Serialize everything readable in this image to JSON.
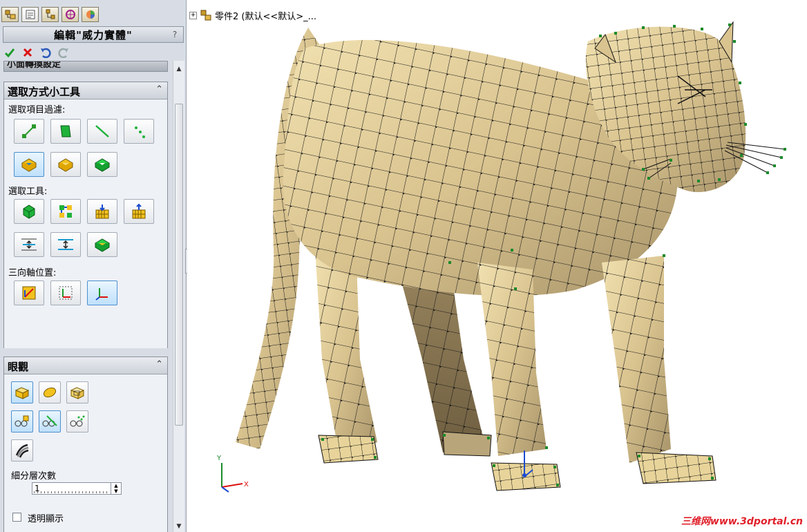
{
  "pm_title": "編輯\"威力實體\"",
  "help_glyph": "?",
  "collapsed_strip_label": "小面轉換設定",
  "selection_group": {
    "title": "選取方式小工具",
    "filter_label": "選取項目過濾:",
    "tools_label": "選取工具:",
    "triad_label": "三向軸位置:"
  },
  "display_group": {
    "title": "眼觀",
    "subdivision_label": "細分層次數",
    "subdivision_value": "1",
    "transparent_label": "透明顯示",
    "transparent_checked": false
  },
  "feature_tree": {
    "expand_glyph": "+",
    "part_label": "零件2  (默认<<默认>_..."
  },
  "triad_axes": {
    "y": "Y",
    "x": "X"
  },
  "watermark": "三维网www.3dportal.cn",
  "colors": {
    "mesh_face": "#d9c38f",
    "mesh_edge": "#1a1a1a",
    "vertex_green": "#1c8a2a",
    "accent_blue": "#4b8fce",
    "watermark_red": "#e0202a"
  }
}
